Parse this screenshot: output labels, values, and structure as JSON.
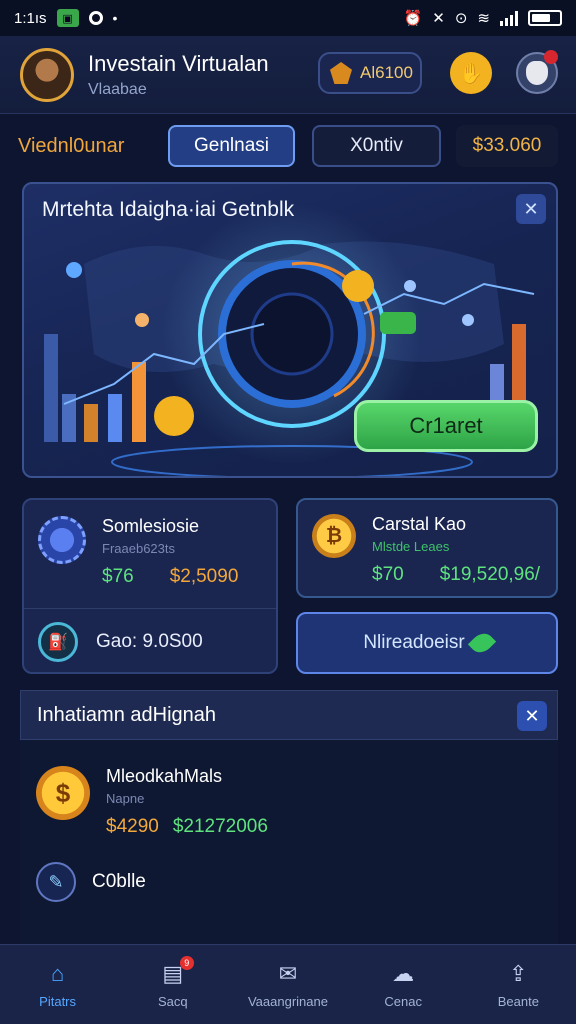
{
  "status_bar": {
    "time": "1:1ıs",
    "right_icons": [
      "alarm-icon",
      "do-not-disturb-icon",
      "wifi-icon",
      "signal-icon",
      "battery-icon"
    ],
    "battery_level": 0.7
  },
  "header": {
    "title": "Investain Virtualan",
    "subtitle": "Vlaabae",
    "coin_balance": "Al6100",
    "colors": {
      "accent": "#f3b320",
      "brand": "#e0a43a"
    }
  },
  "tabs": {
    "label": "Viednl0unar",
    "items": [
      "Genlnasi",
      "X0ntiv"
    ],
    "active_index": 0,
    "balance": "$33.060"
  },
  "hero": {
    "title": "Mrtehta Idaigha·iai Getnblk",
    "cta_label": "Cr1aret"
  },
  "card_a": {
    "title": "Somlesiosie",
    "sub": "Fraaeb623ts",
    "value_green": "$76",
    "value_orange": "$2,5090",
    "gas": "Gao: 9.0S00"
  },
  "card_b": {
    "title": "Carstal Kao",
    "sub": "Mlstde Leaes",
    "value_green": "$70",
    "value_orange": "$19,520,96/"
  },
  "card_c": {
    "label": "Nlireadoeisr"
  },
  "panel": {
    "title": "Inhatiamn adHignah",
    "item1": {
      "title": "MleodkahMals",
      "sub": "Napne",
      "value_orange": "$4290",
      "value_green": "$21272006"
    },
    "item2": {
      "title": "C0blle"
    }
  },
  "bottom_nav": [
    {
      "label": "Pitatrs",
      "icon": "home-icon"
    },
    {
      "label": "Sacq",
      "icon": "wallet-icon",
      "badge": "9"
    },
    {
      "label": "Vaaangrinane",
      "icon": "envelope-icon"
    },
    {
      "label": "Cenac",
      "icon": "cloud-icon"
    },
    {
      "label": "Beante",
      "icon": "share-icon"
    }
  ]
}
